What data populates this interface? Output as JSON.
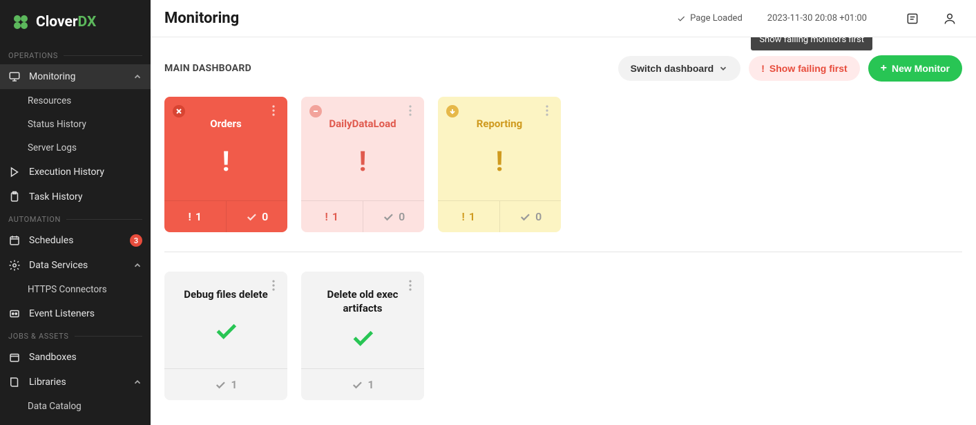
{
  "brand": {
    "name": "Clover",
    "suffix": "DX"
  },
  "header": {
    "title": "Monitoring",
    "status": "Page Loaded",
    "timestamp": "2023-11-30 20:08 +01:00"
  },
  "sidebar": {
    "sections": [
      {
        "label": "OPERATIONS"
      },
      {
        "label": "AUTOMATION"
      },
      {
        "label": "JOBS & ASSETS"
      }
    ],
    "items": {
      "monitoring": "Monitoring",
      "resources": "Resources",
      "status_history": "Status History",
      "server_logs": "Server Logs",
      "execution_history": "Execution History",
      "task_history": "Task History",
      "schedules": "Schedules",
      "schedules_badge": "3",
      "data_services": "Data Services",
      "https_connectors": "HTTPS Connectors",
      "event_listeners": "Event Listeners",
      "sandboxes": "Sandboxes",
      "libraries": "Libraries",
      "data_catalog": "Data Catalog"
    }
  },
  "content": {
    "dashboard_title": "MAIN DASHBOARD",
    "switch_label": "Switch dashboard",
    "failing_label": "Show failing first",
    "new_label": "New Monitor",
    "tooltip": "Show failing monitors first"
  },
  "cards_top": [
    {
      "title": "Orders",
      "fail": "1",
      "ok": "0"
    },
    {
      "title": "DailyDataLoad",
      "fail": "1",
      "ok": "0"
    },
    {
      "title": "Reporting",
      "fail": "1",
      "ok": "0"
    }
  ],
  "cards_bottom": [
    {
      "title": "Debug files delete",
      "ok": "1"
    },
    {
      "title": "Delete old exec artifacts",
      "ok": "1"
    }
  ]
}
